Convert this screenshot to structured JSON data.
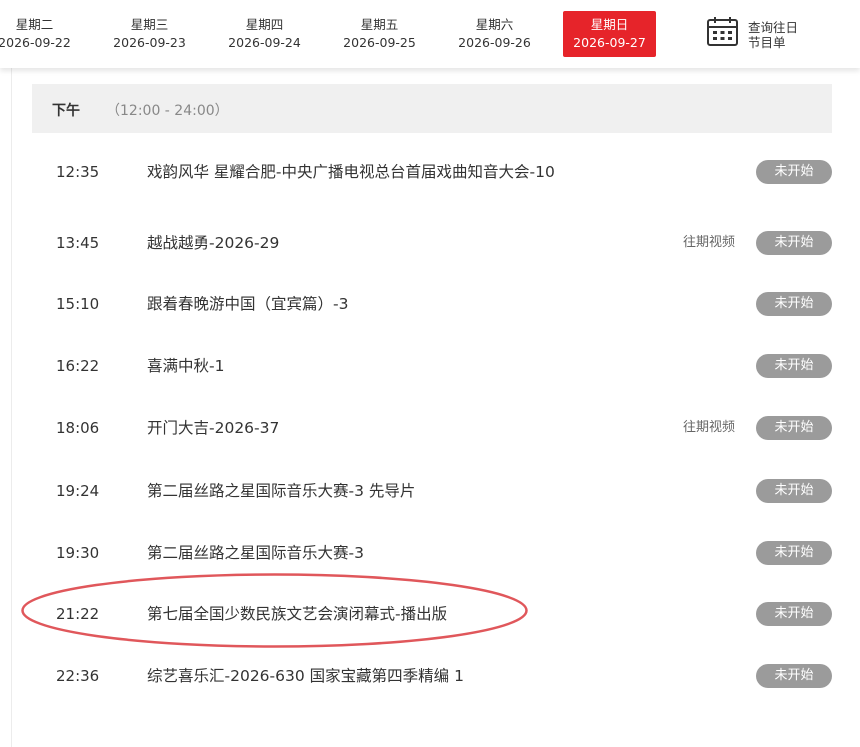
{
  "date_tabs": [
    {
      "weekday": "星期二",
      "date": "2026-09-22",
      "active": false
    },
    {
      "weekday": "星期三",
      "date": "2026-09-23",
      "active": false
    },
    {
      "weekday": "星期四",
      "date": "2026-09-24",
      "active": false
    },
    {
      "weekday": "星期五",
      "date": "2026-09-25",
      "active": false
    },
    {
      "weekday": "星期六",
      "date": "2026-09-26",
      "active": false
    },
    {
      "weekday": "星期日",
      "date": "2026-09-27",
      "active": true
    }
  ],
  "history_button": {
    "line1": "查询往日",
    "line2": "节目单",
    "icon": "calendar-icon"
  },
  "section": {
    "title": "下午",
    "range": "（12:00 - 24:00）"
  },
  "programs": [
    {
      "time": "12:35",
      "title": "戏韵风华 星耀合肥-中央广播电视总台首届戏曲知音大会-10",
      "replay": "",
      "status": "未开始"
    },
    {
      "time": "13:45",
      "title": "越战越勇-2026-29",
      "replay": "往期视频",
      "status": "未开始"
    },
    {
      "time": "15:10",
      "title": "跟着春晚游中国（宜宾篇）-3",
      "replay": "",
      "status": "未开始"
    },
    {
      "time": "16:22",
      "title": "喜满中秋-1",
      "replay": "",
      "status": "未开始"
    },
    {
      "time": "18:06",
      "title": "开门大吉-2026-37",
      "replay": "往期视频",
      "status": "未开始"
    },
    {
      "time": "19:24",
      "title": "第二届丝路之星国际音乐大赛-3 先导片",
      "replay": "",
      "status": "未开始"
    },
    {
      "time": "19:30",
      "title": "第二届丝路之星国际音乐大赛-3",
      "replay": "",
      "status": "未开始"
    },
    {
      "time": "21:22",
      "title": "第七届全国少数民族文艺会演闭幕式-播出版",
      "replay": "",
      "status": "未开始",
      "highlighted": true
    },
    {
      "time": "22:36",
      "title": "综艺喜乐汇-2026-630 国家宝藏第四季精编 1",
      "replay": "",
      "status": "未开始"
    }
  ],
  "colors": {
    "accent": "#e6242a",
    "status_bg": "#9b9b9b",
    "section_bg": "#f0f0f0",
    "highlight": "#e0575b"
  }
}
